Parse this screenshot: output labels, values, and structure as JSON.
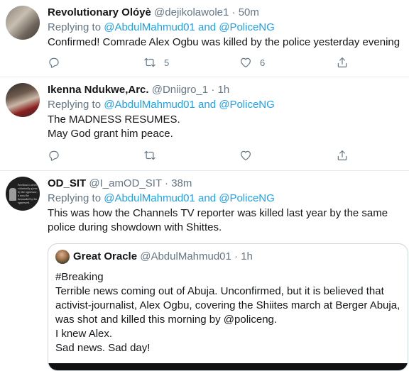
{
  "tweets": [
    {
      "name": "Revolutionary Olóyè",
      "handle": "@dejikolawole1",
      "time": "50m",
      "replying_prefix": "Replying to ",
      "replying_mentions": "@AbdulMahmud01 and @PoliceNG",
      "body": [
        "Confirmed! Comrade Alex Ogbu was killed by the police yesterday evening"
      ],
      "retweet_count": "5",
      "like_count": "6"
    },
    {
      "name": "Ikenna Ndukwe,Arc.",
      "handle": "@Dniigro_1",
      "time": "1h",
      "replying_prefix": "Replying to ",
      "replying_mentions": "@AbdulMahmud01 and @PoliceNG",
      "body": [
        "The MADNESS RESUMES.",
        "May God grant him peace."
      ],
      "retweet_count": "",
      "like_count": ""
    },
    {
      "name": "OD_SIT",
      "handle": "@I_amOD_SIT",
      "time": "38m",
      "replying_prefix": "Replying to ",
      "replying_mentions": "@AbdulMahmud01 and @PoliceNG",
      "body": [
        "This was how the Channels TV reporter was killed last year by the same",
        "police during showdown with Shittes."
      ],
      "avatar_text": "Freedom is never voluntarily given by the oppressor; it must be demanded by the oppressed."
    }
  ],
  "quoted": {
    "name": "Great Oracle",
    "handle": "@AbdulMahmud01",
    "time": "1h",
    "body": [
      "#Breaking",
      "Terrible news coming out of Abuja. Unconfirmed, but it is believed that",
      "activist-journalist, Alex Ogbu, covering the Shiites march at Berger Abuja,",
      "was shot and killed this morning by @policeng.",
      "I knew Alex.",
      "Sad news. Sad day!"
    ]
  },
  "dot": "·",
  "colors": {
    "link": "#1da1f2",
    "muted": "#657786",
    "text": "#14171a",
    "divider": "#e6ecf0"
  },
  "icons": {
    "reply": "reply-icon",
    "retweet": "retweet-icon",
    "like": "like-icon",
    "share": "share-icon"
  }
}
